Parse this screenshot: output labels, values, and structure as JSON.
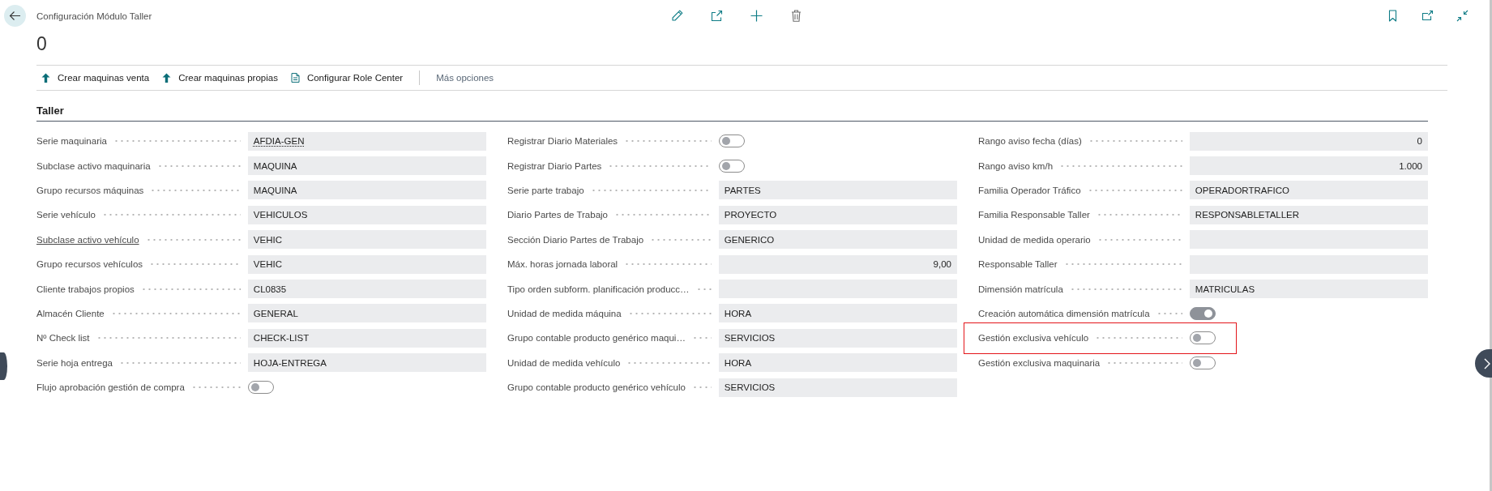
{
  "header": {
    "title": "Configuración Módulo Taller",
    "record": "0"
  },
  "actions": [
    {
      "label": "Crear maquinas venta",
      "kind": "arrow"
    },
    {
      "label": "Crear maquinas propias",
      "kind": "arrow"
    },
    {
      "label": "Configurar Role Center",
      "kind": "page"
    }
  ],
  "more_actions": "Más opciones",
  "section": {
    "title": "Taller",
    "columns": [
      {
        "fields": [
          {
            "label": "Serie maquinaria",
            "kind": "text",
            "value": "AFDIA-GEN",
            "label_underlined": false,
            "value_underlined": true,
            "highlighted": false
          },
          {
            "label": "Subclase activo maquinaria",
            "kind": "text",
            "value": "MAQUINA",
            "label_underlined": false,
            "value_underlined": false,
            "highlighted": false
          },
          {
            "label": "Grupo recursos máquinas",
            "kind": "text",
            "value": "MAQUINA",
            "label_underlined": false,
            "value_underlined": false,
            "highlighted": false
          },
          {
            "label": "Serie vehículo",
            "kind": "text",
            "value": "VEHICULOS",
            "label_underlined": false,
            "value_underlined": false,
            "highlighted": false
          },
          {
            "label": "Subclase activo vehículo",
            "kind": "text",
            "value": "VEHIC",
            "label_underlined": true,
            "value_underlined": false,
            "highlighted": false
          },
          {
            "label": "Grupo recursos vehículos",
            "kind": "text",
            "value": "VEHIC",
            "label_underlined": false,
            "value_underlined": false,
            "highlighted": false
          },
          {
            "label": "Cliente trabajos propios",
            "kind": "text",
            "value": "CL0835",
            "label_underlined": false,
            "value_underlined": false,
            "highlighted": false
          },
          {
            "label": "Almacén Cliente",
            "kind": "text",
            "value": "GENERAL",
            "label_underlined": false,
            "value_underlined": false,
            "highlighted": false
          },
          {
            "label": "Nº Check list",
            "kind": "text",
            "value": "CHECK-LIST",
            "label_underlined": false,
            "value_underlined": false,
            "highlighted": false
          },
          {
            "label": "Serie hoja entrega",
            "kind": "text",
            "value": "HOJA-ENTREGA",
            "label_underlined": false,
            "value_underlined": false,
            "highlighted": false
          },
          {
            "label": "Flujo aprobación gestión de compra",
            "kind": "toggle",
            "on": false,
            "label_underlined": false,
            "highlighted": false
          }
        ]
      },
      {
        "fields": [
          {
            "label": "Registrar Diario Materiales",
            "kind": "toggle",
            "on": false,
            "label_underlined": false,
            "highlighted": false
          },
          {
            "label": "Registrar Diario Partes",
            "kind": "toggle",
            "on": false,
            "label_underlined": false,
            "highlighted": false
          },
          {
            "label": "Serie parte trabajo",
            "kind": "text",
            "value": "PARTES",
            "label_underlined": false,
            "value_underlined": false,
            "highlighted": false
          },
          {
            "label": "Diario Partes de Trabajo",
            "kind": "text",
            "value": "PROYECTO",
            "label_underlined": false,
            "value_underlined": false,
            "highlighted": false
          },
          {
            "label": "Sección Diario Partes de Trabajo",
            "kind": "text",
            "value": "GENERICO",
            "label_underlined": false,
            "value_underlined": false,
            "highlighted": false
          },
          {
            "label": "Máx. horas jornada laboral",
            "kind": "number",
            "value": "9,00",
            "label_underlined": false,
            "value_underlined": false,
            "highlighted": false
          },
          {
            "label": "Tipo orden subform. planificación producc…",
            "kind": "text",
            "label_underlined": false,
            "highlighted": false
          },
          {
            "label": "Unidad de medida máquina",
            "kind": "text",
            "value": "HORA",
            "label_underlined": false,
            "value_underlined": false,
            "highlighted": false
          },
          {
            "label": "Grupo contable producto genérico maqui…",
            "kind": "text",
            "value": "SERVICIOS",
            "label_underlined": false,
            "value_underlined": false,
            "highlighted": false
          },
          {
            "label": "Unidad de medida vehículo",
            "kind": "text",
            "value": "HORA",
            "label_underlined": false,
            "value_underlined": false,
            "highlighted": false
          },
          {
            "label": "Grupo contable producto genérico vehículo",
            "kind": "text",
            "value": "SERVICIOS",
            "label_underlined": false,
            "value_underlined": false,
            "highlighted": false
          }
        ]
      },
      {
        "fields": [
          {
            "label": "Rango aviso fecha (días)",
            "kind": "number",
            "value": "0",
            "label_underlined": false,
            "value_underlined": false,
            "highlighted": false
          },
          {
            "label": "Rango aviso km/h",
            "kind": "number",
            "value": "1.000",
            "label_underlined": false,
            "value_underlined": false,
            "highlighted": false
          },
          {
            "label": "Familia Operador Tráfico",
            "kind": "text",
            "value": "OPERADORTRAFICO",
            "label_underlined": false,
            "value_underlined": false,
            "highlighted": false
          },
          {
            "label": "Familia Responsable Taller",
            "kind": "text",
            "value": "RESPONSABLETALLER",
            "label_underlined": false,
            "value_underlined": false,
            "highlighted": false
          },
          {
            "label": "Unidad de medida operario",
            "kind": "text",
            "label_underlined": false,
            "highlighted": false
          },
          {
            "label": "Responsable Taller",
            "kind": "text",
            "label_underlined": false,
            "highlighted": false
          },
          {
            "label": "Dimensión matrícula",
            "kind": "text",
            "value": "MATRICULAS",
            "label_underlined": false,
            "value_underlined": false,
            "highlighted": false
          },
          {
            "label": "Creación automática dimensión matrícula",
            "kind": "toggle",
            "on": true,
            "label_underlined": false,
            "highlighted": false
          },
          {
            "label": "Gestión exclusiva vehículo",
            "kind": "toggle",
            "on": false,
            "label_underlined": false,
            "highlighted": true
          },
          {
            "label": "Gestión exclusiva maquinaria",
            "kind": "toggle",
            "on": false,
            "label_underlined": false,
            "highlighted": false
          }
        ]
      }
    ]
  }
}
